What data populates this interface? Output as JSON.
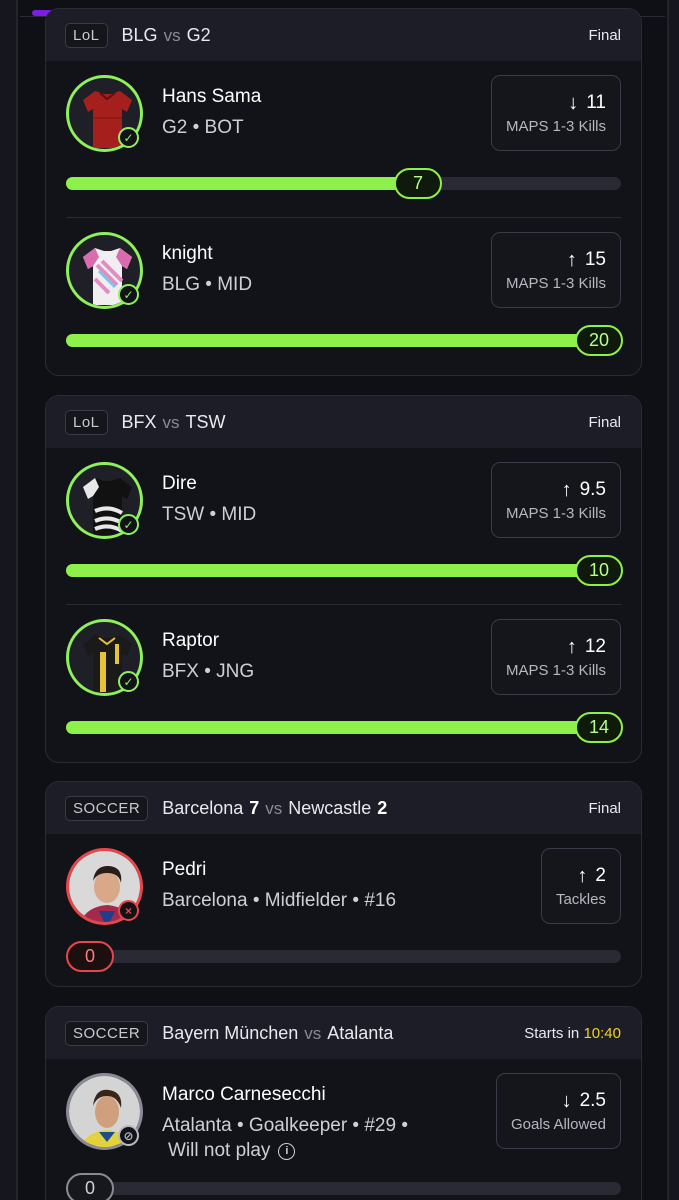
{
  "cards": [
    {
      "tag": "LoL",
      "team1": "BLG",
      "vs": "vs",
      "team2": "G2",
      "status": "Final",
      "players": [
        {
          "name": "Hans Sama",
          "meta": "G2 • BOT",
          "direction": "down",
          "line": "11",
          "stat": "MAPS 1-3 Kills",
          "result": "7",
          "progress": 0.68
        },
        {
          "name": "knight",
          "meta": "BLG • MID",
          "direction": "up",
          "line": "15",
          "stat": "MAPS 1-3 Kills",
          "result": "20",
          "progress": 1.0
        }
      ]
    },
    {
      "tag": "LoL",
      "team1": "BFX",
      "vs": "vs",
      "team2": "TSW",
      "status": "Final",
      "players": [
        {
          "name": "Dire",
          "meta": "TSW • MID",
          "direction": "up",
          "line": "9.5",
          "stat": "MAPS 1-3 Kills",
          "result": "10",
          "progress": 1.0
        },
        {
          "name": "Raptor",
          "meta": "BFX • JNG",
          "direction": "up",
          "line": "12",
          "stat": "MAPS 1-3 Kills",
          "result": "14",
          "progress": 1.0
        }
      ]
    },
    {
      "tag": "SOCCER",
      "team1": "Barcelona",
      "score1": "7",
      "vs": "vs",
      "team2": "Newcastle",
      "score2": "2",
      "status": "Final",
      "players": [
        {
          "name": "Pedri",
          "meta": "Barcelona • Midfielder • #16",
          "direction": "up",
          "line": "2",
          "stat": "Tackles",
          "result": "0",
          "progress": 0
        }
      ]
    },
    {
      "tag": "SOCCER",
      "team1": "Bayern München",
      "vs": "vs",
      "team2": "Atalanta",
      "status_prefix": "Starts in",
      "status_time": "10:40",
      "players": [
        {
          "name": "Marco Carnesecchi",
          "meta": "Atalanta • Goalkeeper • #29 •",
          "meta2": "Will not play",
          "direction": "down",
          "line": "2.5",
          "stat": "Goals Allowed",
          "result": "0",
          "progress": 0
        }
      ]
    }
  ],
  "icons": {
    "arrow_up": "↑",
    "arrow_down": "↓",
    "check": "✓",
    "cross": "×",
    "na": "⊘",
    "info": "i"
  },
  "colors": {
    "accent_green": "#8ef04a",
    "loss_red": "#e5474a",
    "brand_purple": "#7a1fe0",
    "starts_yellow": "#f2d21a"
  }
}
